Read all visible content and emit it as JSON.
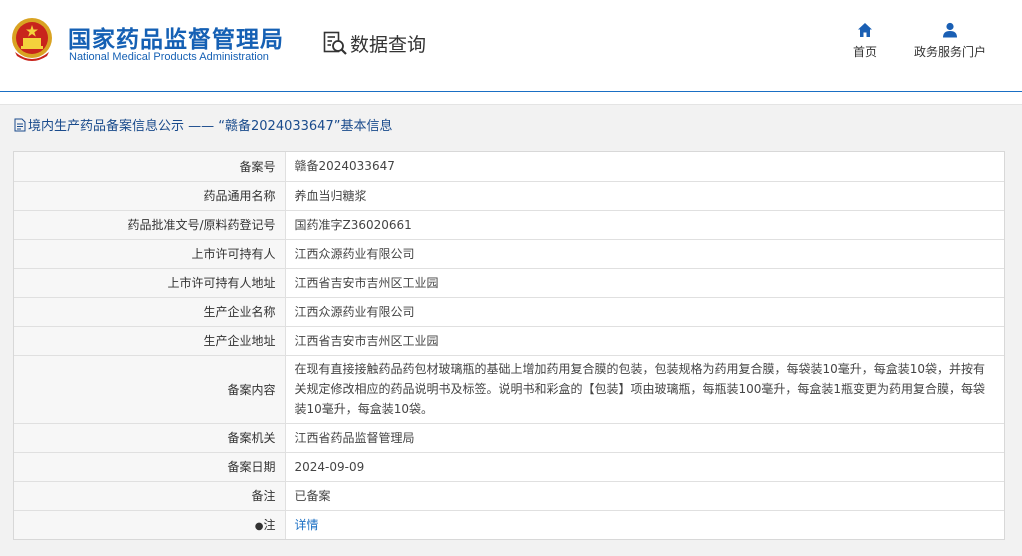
{
  "header": {
    "brand_cn": "国家药品监督管理局",
    "brand_en": "National Medical Products Administration",
    "query_label": "数据查询",
    "nav": {
      "home": "首页",
      "portal": "政务服务门户"
    },
    "accent_color": "#1560b4"
  },
  "panel": {
    "title": "境内生产药品备案信息公示 —— “赣备2024033647”基本信息"
  },
  "record": {
    "rows": [
      {
        "label": "备案号",
        "value": "赣备2024033647"
      },
      {
        "label": "药品通用名称",
        "value": "养血当归糖浆"
      },
      {
        "label": "药品批准文号/原料药登记号",
        "value": "国药准字Z36020661"
      },
      {
        "label": "上市许可持有人",
        "value": "江西众源药业有限公司"
      },
      {
        "label": "上市许可持有人地址",
        "value": "江西省吉安市吉州区工业园"
      },
      {
        "label": "生产企业名称",
        "value": "江西众源药业有限公司"
      },
      {
        "label": "生产企业地址",
        "value": "江西省吉安市吉州区工业园"
      },
      {
        "label": "备案内容",
        "value": "在现有直接接触药品药包材玻璃瓶的基础上增加药用复合膜的包装，包装规格为药用复合膜，每袋装10毫升，每盒装10袋，并按有关规定修改相应的药品说明书及标签。说明书和彩盒的【包装】项由玻璃瓶，每瓶装100毫升，每盒装1瓶变更为药用复合膜，每袋装10毫升，每盒装10袋。"
      },
      {
        "label": "备案机关",
        "value": "江西省药品监督管理局"
      },
      {
        "label": "备案日期",
        "value": "2024-09-09"
      },
      {
        "label": "备注",
        "value": "已备案"
      },
      {
        "label": "注",
        "value": "详情"
      }
    ]
  }
}
